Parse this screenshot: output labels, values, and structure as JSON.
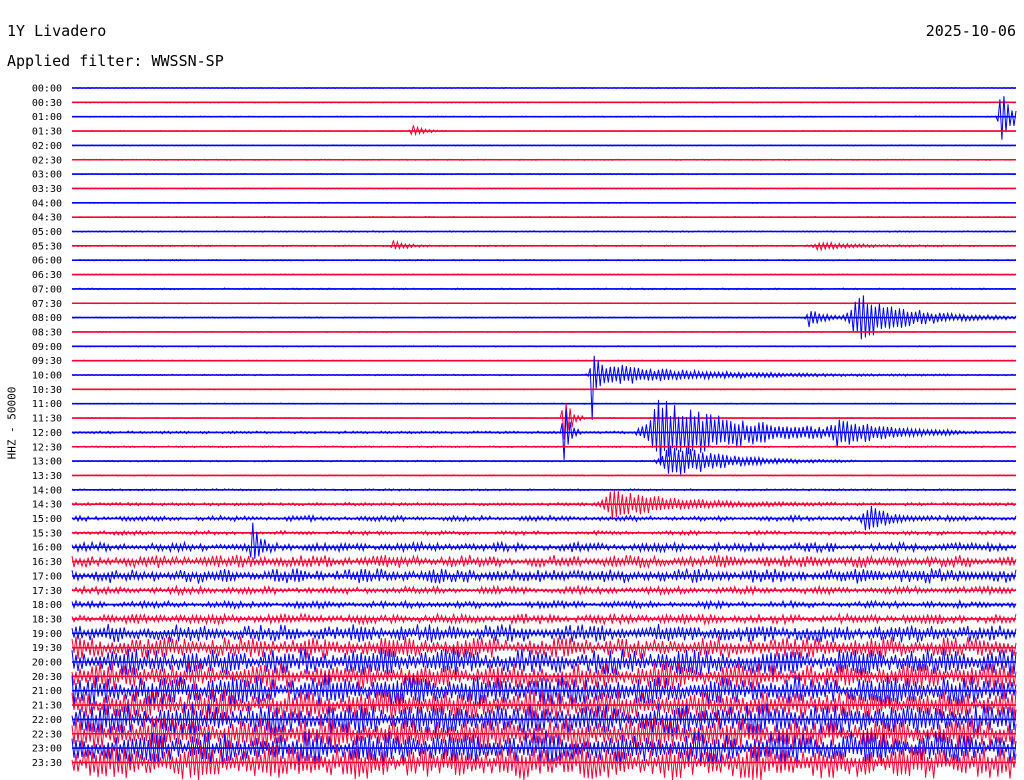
{
  "header": {
    "station": "1Y Livadero",
    "date": "2025-10-06",
    "filter": "Applied filter: WWSSN-SP"
  },
  "chart_data": {
    "type": "line",
    "title": "1Y Livadero",
    "date": "2025-10-06",
    "filter": "WWSSN-SP",
    "ylabel": "HHZ - 50000",
    "row_labels": [
      "00:00",
      "00:30",
      "01:00",
      "01:30",
      "02:00",
      "02:30",
      "03:00",
      "03:30",
      "04:00",
      "04:30",
      "05:00",
      "05:30",
      "06:00",
      "06:30",
      "07:00",
      "07:30",
      "08:00",
      "08:30",
      "09:00",
      "09:30",
      "10:00",
      "10:30",
      "11:00",
      "11:30",
      "12:00",
      "12:30",
      "13:00",
      "13:30",
      "14:00",
      "14:30",
      "15:00",
      "15:30",
      "16:00",
      "16:30",
      "17:00",
      "17:30",
      "18:00",
      "18:30",
      "19:00",
      "19:30",
      "20:00",
      "20:30",
      "21:00",
      "21:30",
      "22:00",
      "22:30",
      "23:00",
      "23:30"
    ],
    "trace_colors": [
      "#0000ff",
      "#ff0033"
    ],
    "relative_noise": [
      0.3,
      0.3,
      0.35,
      0.3,
      0.3,
      0.35,
      0.35,
      0.3,
      0.3,
      0.35,
      0.45,
      0.45,
      0.4,
      0.35,
      0.5,
      0.3,
      0.4,
      0.3,
      0.35,
      0.3,
      0.45,
      0.3,
      0.35,
      0.35,
      0.8,
      0.5,
      0.45,
      0.35,
      0.6,
      1.0,
      1.6,
      1.2,
      2.6,
      3.5,
      4.2,
      2.2,
      2.0,
      2.8,
      5.0,
      6.0,
      7.5,
      7.5,
      8.5,
      8.5,
      9.0,
      9.0,
      9.0,
      9.5
    ],
    "events": [
      {
        "row": 2,
        "time_fraction": 0.983,
        "amplitude": 28,
        "duration": 0.012
      },
      {
        "row": 3,
        "time_fraction": 0.36,
        "amplitude": 7,
        "duration": 0.01
      },
      {
        "row": 11,
        "time_fraction": 0.34,
        "amplitude": 6,
        "duration": 0.012
      },
      {
        "row": 11,
        "time_fraction": 0.79,
        "amplitude": 4,
        "duration": 0.04
      },
      {
        "row": 16,
        "time_fraction": 0.83,
        "amplitude": 25,
        "duration": 0.05
      },
      {
        "row": 16,
        "time_fraction": 0.78,
        "amplitude": 10,
        "duration": 0.015
      },
      {
        "row": 20,
        "time_fraction": 0.55,
        "amplitude": 55,
        "duration": 0.005
      },
      {
        "row": 20,
        "time_fraction": 0.57,
        "amplitude": 11,
        "duration": 0.09
      },
      {
        "row": 23,
        "time_fraction": 0.52,
        "amplitude": 40,
        "duration": 0.006
      },
      {
        "row": 24,
        "time_fraction": 0.52,
        "amplitude": 45,
        "duration": 0.005
      },
      {
        "row": 24,
        "time_fraction": 0.62,
        "amplitude": 35,
        "duration": 0.08
      },
      {
        "row": 24,
        "time_fraction": 0.81,
        "amplitude": 12,
        "duration": 0.04
      },
      {
        "row": 26,
        "time_fraction": 0.63,
        "amplitude": 20,
        "duration": 0.05
      },
      {
        "row": 29,
        "time_fraction": 0.57,
        "amplitude": 15,
        "duration": 0.06
      },
      {
        "row": 30,
        "time_fraction": 0.84,
        "amplitude": 14,
        "duration": 0.02
      },
      {
        "row": 32,
        "time_fraction": 0.19,
        "amplitude": 30,
        "duration": 0.006
      }
    ]
  }
}
